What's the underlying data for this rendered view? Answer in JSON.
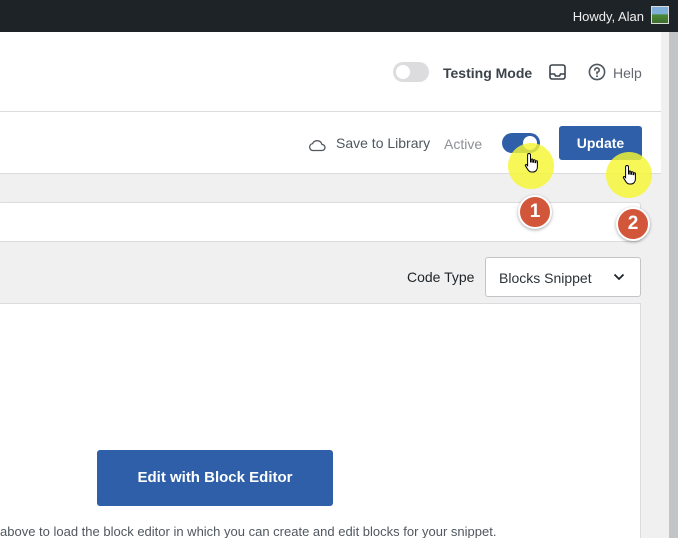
{
  "admin_bar": {
    "greeting": "Howdy, Alan"
  },
  "topbar": {
    "testing_mode_label": "Testing Mode",
    "testing_mode_enabled": false,
    "help_label": "Help"
  },
  "actionbar": {
    "save_to_library_label": "Save to Library",
    "active_label": "Active",
    "active_enabled": true,
    "update_label": "Update"
  },
  "annotations": {
    "step1": "1",
    "step2": "2",
    "highlight_color": "#f5f532",
    "badge_color": "#d2573a"
  },
  "code_type": {
    "label": "Code Type",
    "selected": "Blocks Snippet"
  },
  "editor": {
    "edit_button_label": "Edit with Block Editor",
    "help_text": "above to load the block editor in which you can create and edit blocks for your snippet."
  },
  "colors": {
    "accent": "#2e5fa8",
    "admin_bar": "#1d2327"
  }
}
